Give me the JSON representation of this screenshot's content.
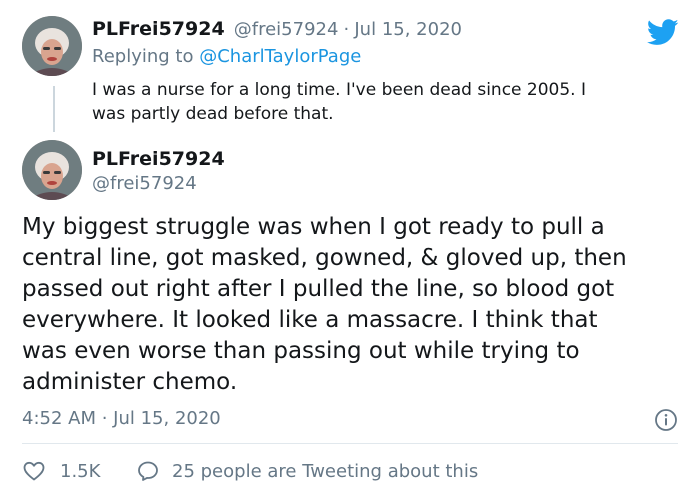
{
  "reply_tweet": {
    "display_name": "PLFrei57924",
    "handle": "@frei57924",
    "date": "Jul 15, 2020",
    "separator": "·",
    "replying_prefix": "Replying to",
    "replying_to": "@CharlTaylorPage",
    "text_line1": "I was a nurse for a long time. I've been dead since 2005. I",
    "text_line2": "was partly dead before that."
  },
  "main_tweet": {
    "display_name": "PLFrei57924",
    "handle": "@frei57924",
    "text_lines": [
      "My biggest struggle was when I got ready to pull a",
      "central line, got masked, gowned, & gloved up, then",
      "passed out right after I pulled the line, so blood got",
      "everywhere. It looked like a massacre. I think that",
      "was even worse than passing out while trying to",
      "administer chemo."
    ],
    "timestamp": "4:52 AM · Jul 15, 2020",
    "likes": "1.5K",
    "conversation": "25 people are Tweeting about this"
  },
  "icons": {
    "brand": "twitter-bird-icon",
    "info": "info-icon",
    "like": "heart-icon",
    "reply": "speech-bubble-icon"
  },
  "colors": {
    "brand_blue": "#1da1f2",
    "link_blue": "#1b95e0",
    "secondary_text": "#657786",
    "primary_text": "#14171a",
    "divider": "#e1e8ed"
  }
}
